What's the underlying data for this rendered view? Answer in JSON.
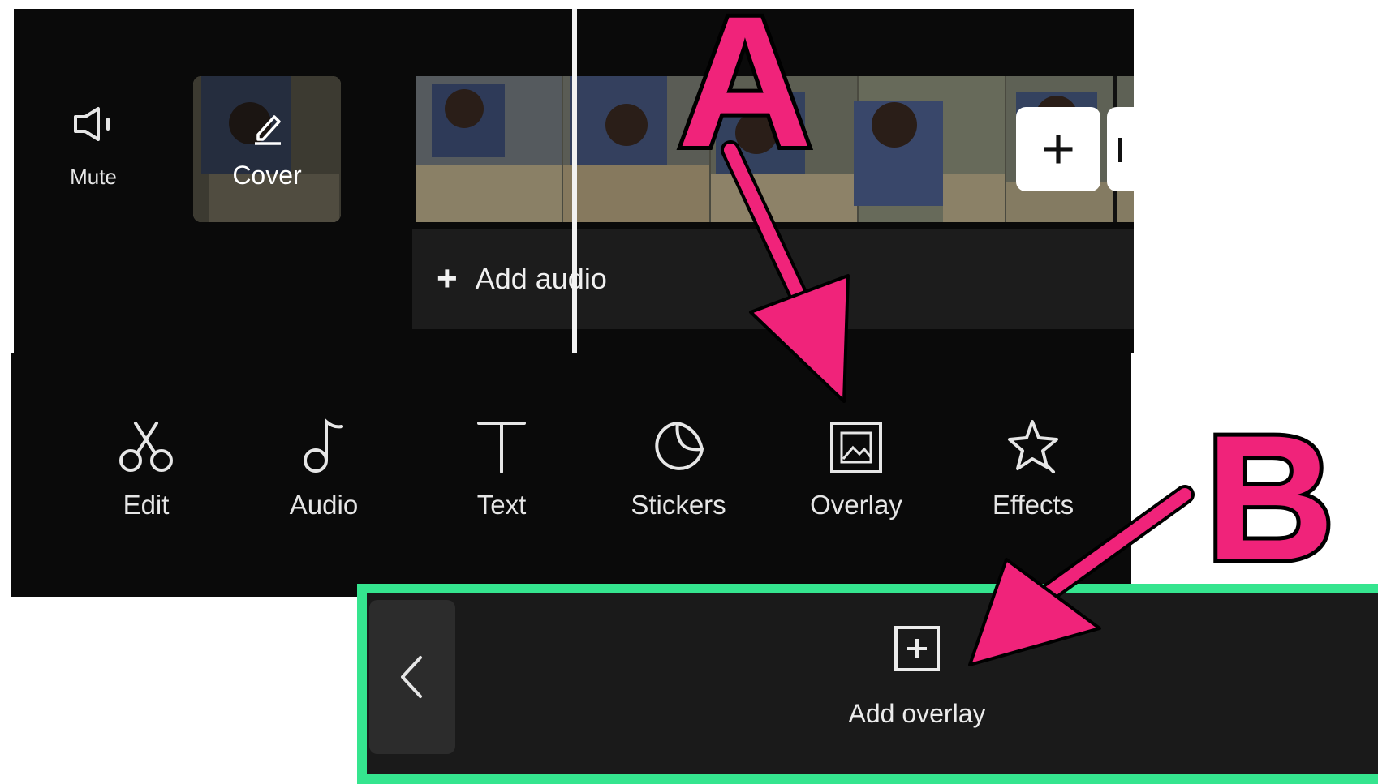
{
  "timeline": {
    "mute_label": "Mute",
    "cover_label": "Cover",
    "add_audio_label": "Add audio",
    "add_clip_symbol": "+"
  },
  "toolbar": {
    "items": [
      {
        "label": "Edit",
        "icon": "scissors-icon"
      },
      {
        "label": "Audio",
        "icon": "music-note-icon"
      },
      {
        "label": "Text",
        "icon": "text-icon"
      },
      {
        "label": "Stickers",
        "icon": "sticker-icon"
      },
      {
        "label": "Overlay",
        "icon": "overlay-icon"
      },
      {
        "label": "Effects",
        "icon": "star-effects-icon"
      }
    ]
  },
  "overlay_panel": {
    "add_overlay_label": "Add overlay",
    "back_icon": "chevron-left-icon"
  },
  "annotations": {
    "label_a": "A",
    "label_b": "B",
    "arrow_color": "#f0237a",
    "panel_border_color": "#35e58f"
  }
}
